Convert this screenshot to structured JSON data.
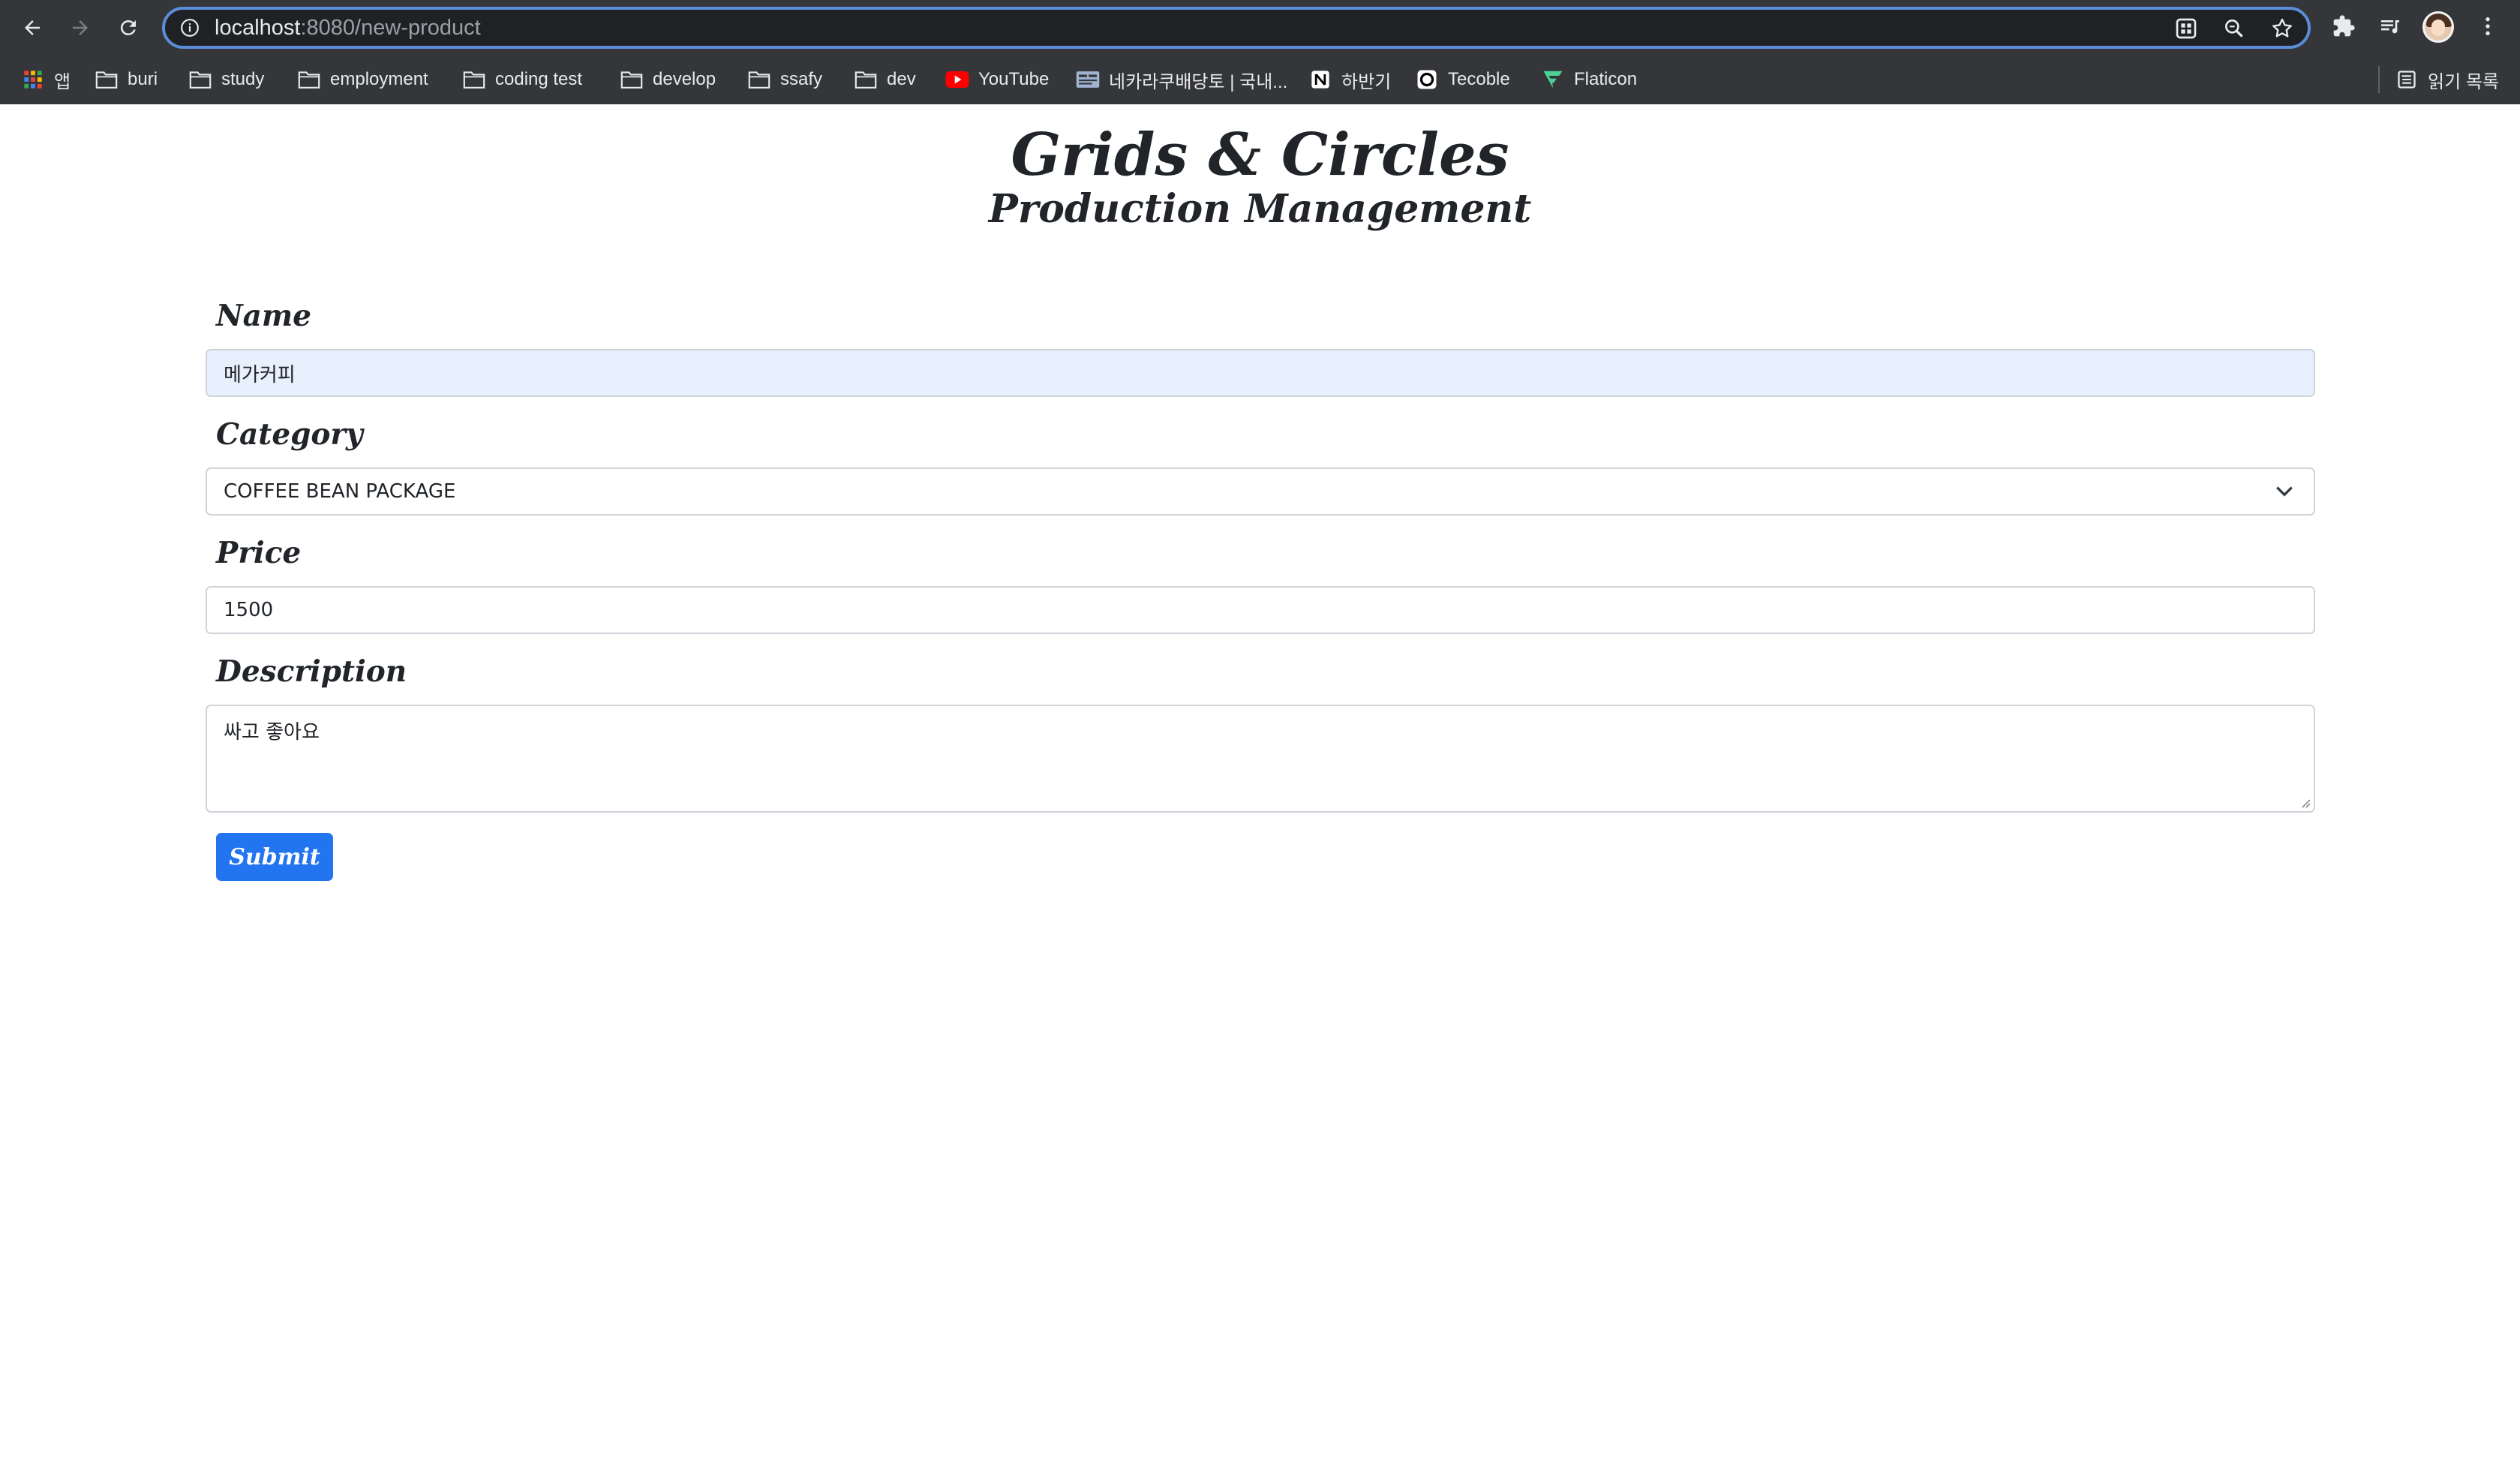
{
  "browser": {
    "url_host": "localhost",
    "url_path": ":8080/new-product",
    "bookmarks": [
      {
        "label": "앱",
        "icon": "apps-grid-icon"
      },
      {
        "label": "buri",
        "icon": "folder-icon"
      },
      {
        "label": "study",
        "icon": "folder-icon"
      },
      {
        "label": "employment",
        "icon": "folder-icon"
      },
      {
        "label": "coding test",
        "icon": "folder-icon"
      },
      {
        "label": "develop",
        "icon": "folder-icon"
      },
      {
        "label": "ssafy",
        "icon": "folder-icon"
      },
      {
        "label": "dev",
        "icon": "folder-icon"
      },
      {
        "label": "YouTube",
        "icon": "youtube-icon"
      },
      {
        "label": "네카라쿠배당토 | 국내...",
        "icon": "site-favicon-icon"
      },
      {
        "label": "하반기",
        "icon": "notion-icon"
      },
      {
        "label": "Tecoble",
        "icon": "tecoble-icon"
      },
      {
        "label": "Flaticon",
        "icon": "flaticon-icon"
      }
    ],
    "reading_list": "읽기 목록",
    "colors": {
      "chrome_bg": "#35363a",
      "omnibox_bg": "#202124",
      "omnibox_focus": "#5b8dd9"
    }
  },
  "page": {
    "title": "Grids & Circles",
    "subtitle": "Production Management",
    "form": {
      "name_label": "Name",
      "name_value": "메가커피",
      "category_label": "Category",
      "category_value": "COFFEE BEAN PACKAGE",
      "price_label": "Price",
      "price_value": "1500",
      "description_label": "Description",
      "description_value": "싸고 좋아요",
      "submit_label": "Submit"
    },
    "colors": {
      "primary": "#2374f1",
      "autofill_bg": "#e8f0fe",
      "text": "#212529"
    }
  }
}
